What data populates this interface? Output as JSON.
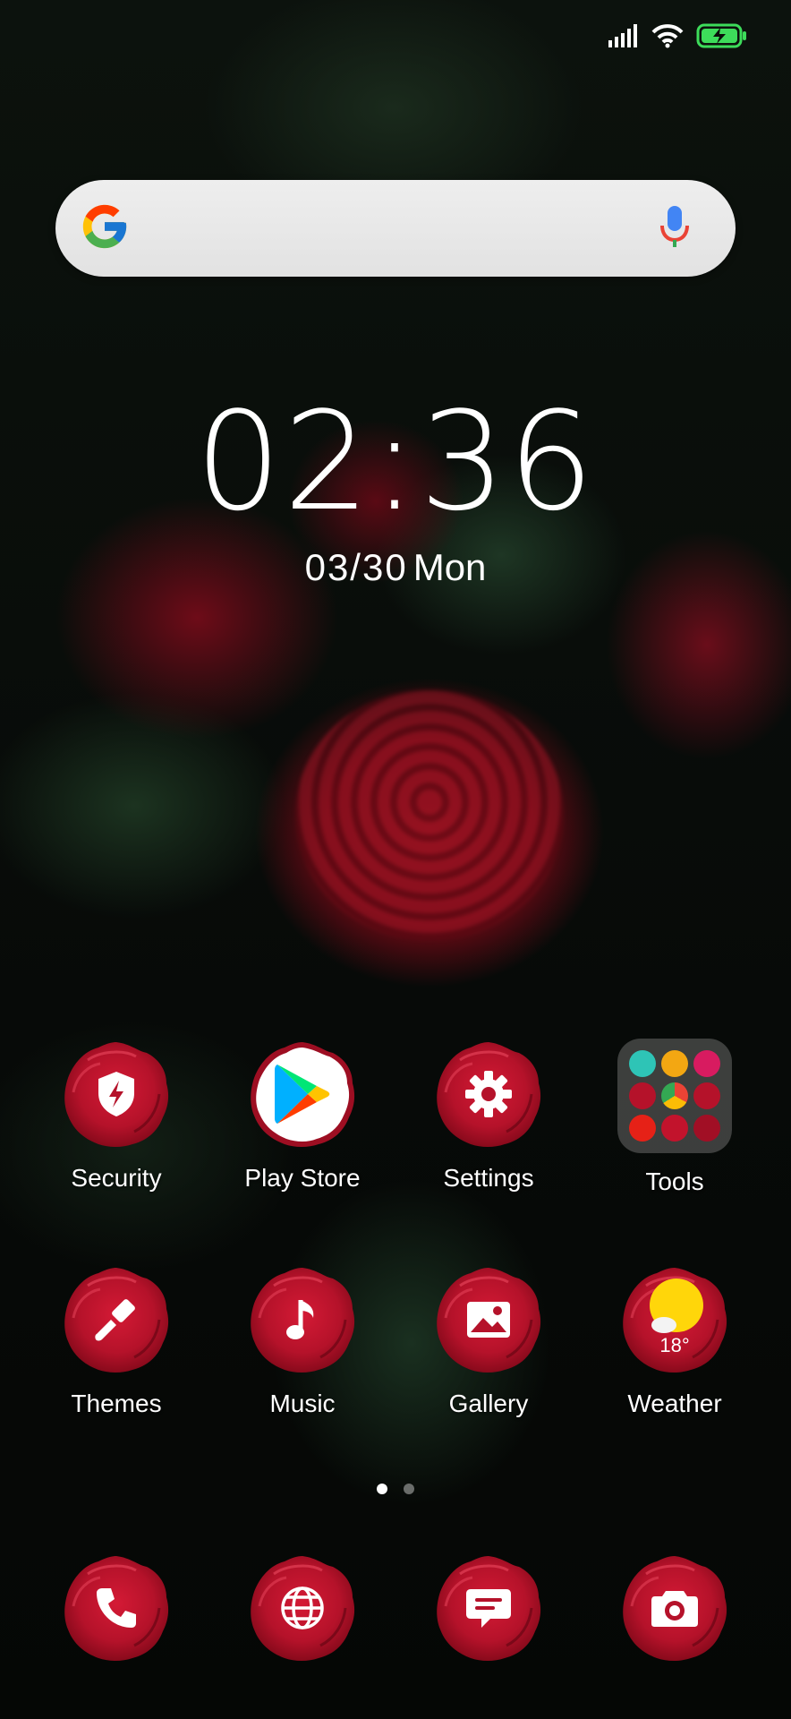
{
  "status_bar": {
    "battery_state": "charging",
    "icons": [
      "signal-icon",
      "wifi-icon",
      "battery-charging-icon"
    ]
  },
  "search": {
    "icons": [
      "google-g-icon",
      "microphone-icon"
    ]
  },
  "clock": {
    "time": "02:36",
    "date": "03/30",
    "weekday": "Mon"
  },
  "apps_row1": [
    {
      "label": "Security",
      "icon": "shield-bolt-icon"
    },
    {
      "label": "Play Store",
      "icon": "play-store-icon"
    },
    {
      "label": "Settings",
      "icon": "gear-icon"
    },
    {
      "label": "Tools",
      "icon": "folder-icon"
    }
  ],
  "apps_row2": [
    {
      "label": "Themes",
      "icon": "paintbrush-icon"
    },
    {
      "label": "Music",
      "icon": "music-note-icon"
    },
    {
      "label": "Gallery",
      "icon": "image-icon"
    },
    {
      "label": "Weather",
      "icon": "weather-sun-icon",
      "temp": "18°"
    }
  ],
  "page_indicator": {
    "pages": 2,
    "current": 1
  },
  "dock": [
    {
      "icon": "phone-icon"
    },
    {
      "icon": "globe-icon"
    },
    {
      "icon": "message-icon"
    },
    {
      "icon": "camera-icon"
    }
  ],
  "colors": {
    "rose": "#b5122a",
    "rose_dark": "#7d0818",
    "battery": "#3ddc5a",
    "text": "#ffffff"
  }
}
